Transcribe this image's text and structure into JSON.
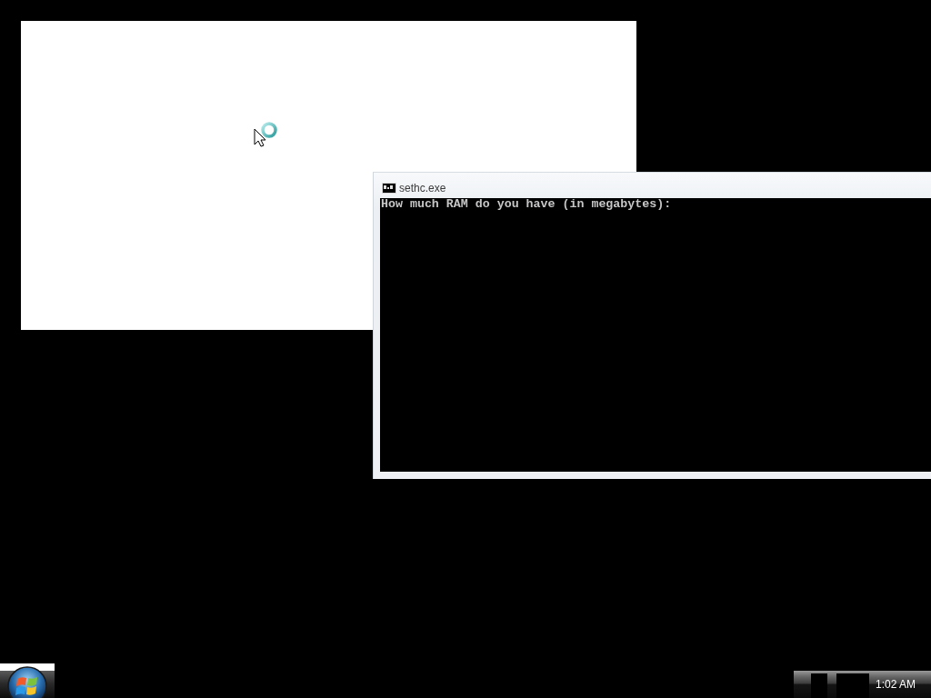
{
  "console_window": {
    "title": "sethc.exe",
    "lines": [
      "How much RAM do you have (in megabytes):"
    ]
  },
  "taskbar": {
    "clock": "1:02 AM"
  }
}
